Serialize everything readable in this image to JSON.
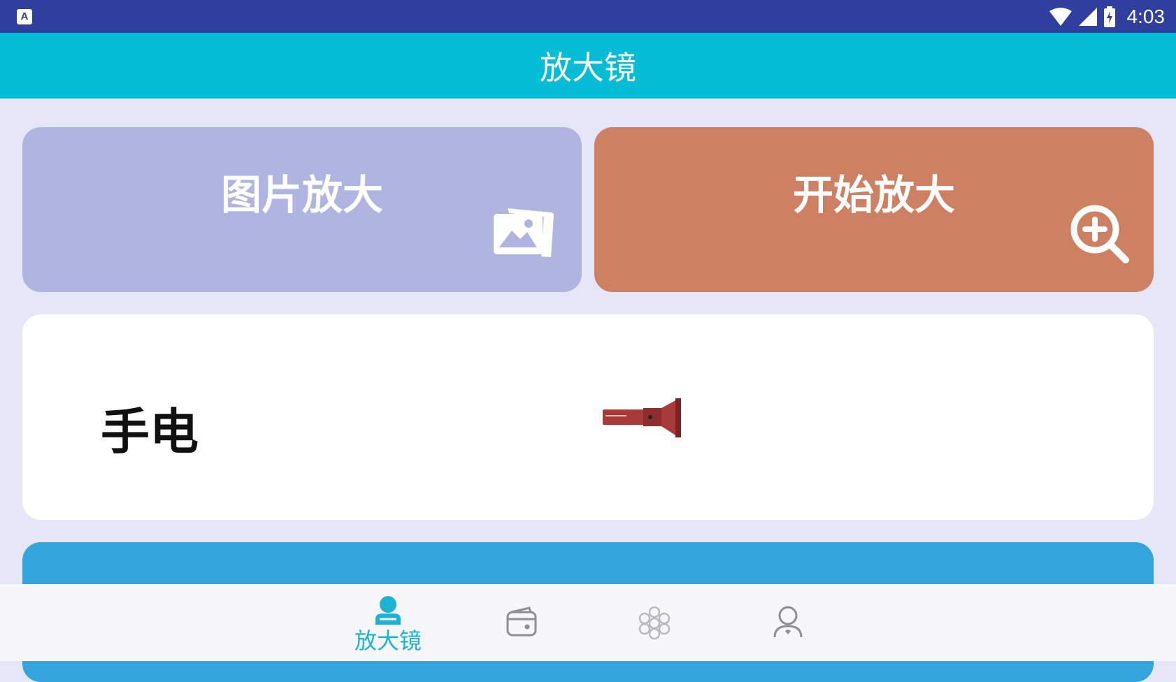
{
  "status_bar": {
    "time": "4:03",
    "notification_icon": "A"
  },
  "app_bar": {
    "title": "放大镜"
  },
  "cards": {
    "image_zoom": {
      "label": "图片放大",
      "icon": "gallery-icon"
    },
    "start_zoom": {
      "label": "开始放大",
      "icon": "zoom-in-icon"
    },
    "flashlight": {
      "label": "手电",
      "icon": "flashlight-icon"
    }
  },
  "bottom_nav": {
    "items": [
      {
        "label": "放大镜",
        "icon": "person-icon",
        "active": true
      },
      {
        "label": "",
        "icon": "wallet-icon",
        "active": false
      },
      {
        "label": "",
        "icon": "hexagon-cluster-icon",
        "active": false
      },
      {
        "label": "",
        "icon": "user-profile-icon",
        "active": false
      }
    ]
  },
  "colors": {
    "status_bar": "#303F9F",
    "app_bar": "#03BCD6",
    "background": "#E5E6F8",
    "image_card": "#AFB4E0",
    "zoom_card": "#CD8062",
    "blue_card": "#34A4DC",
    "nav_active": "#1BB3D3",
    "nav_inactive": "#8E8E93"
  }
}
